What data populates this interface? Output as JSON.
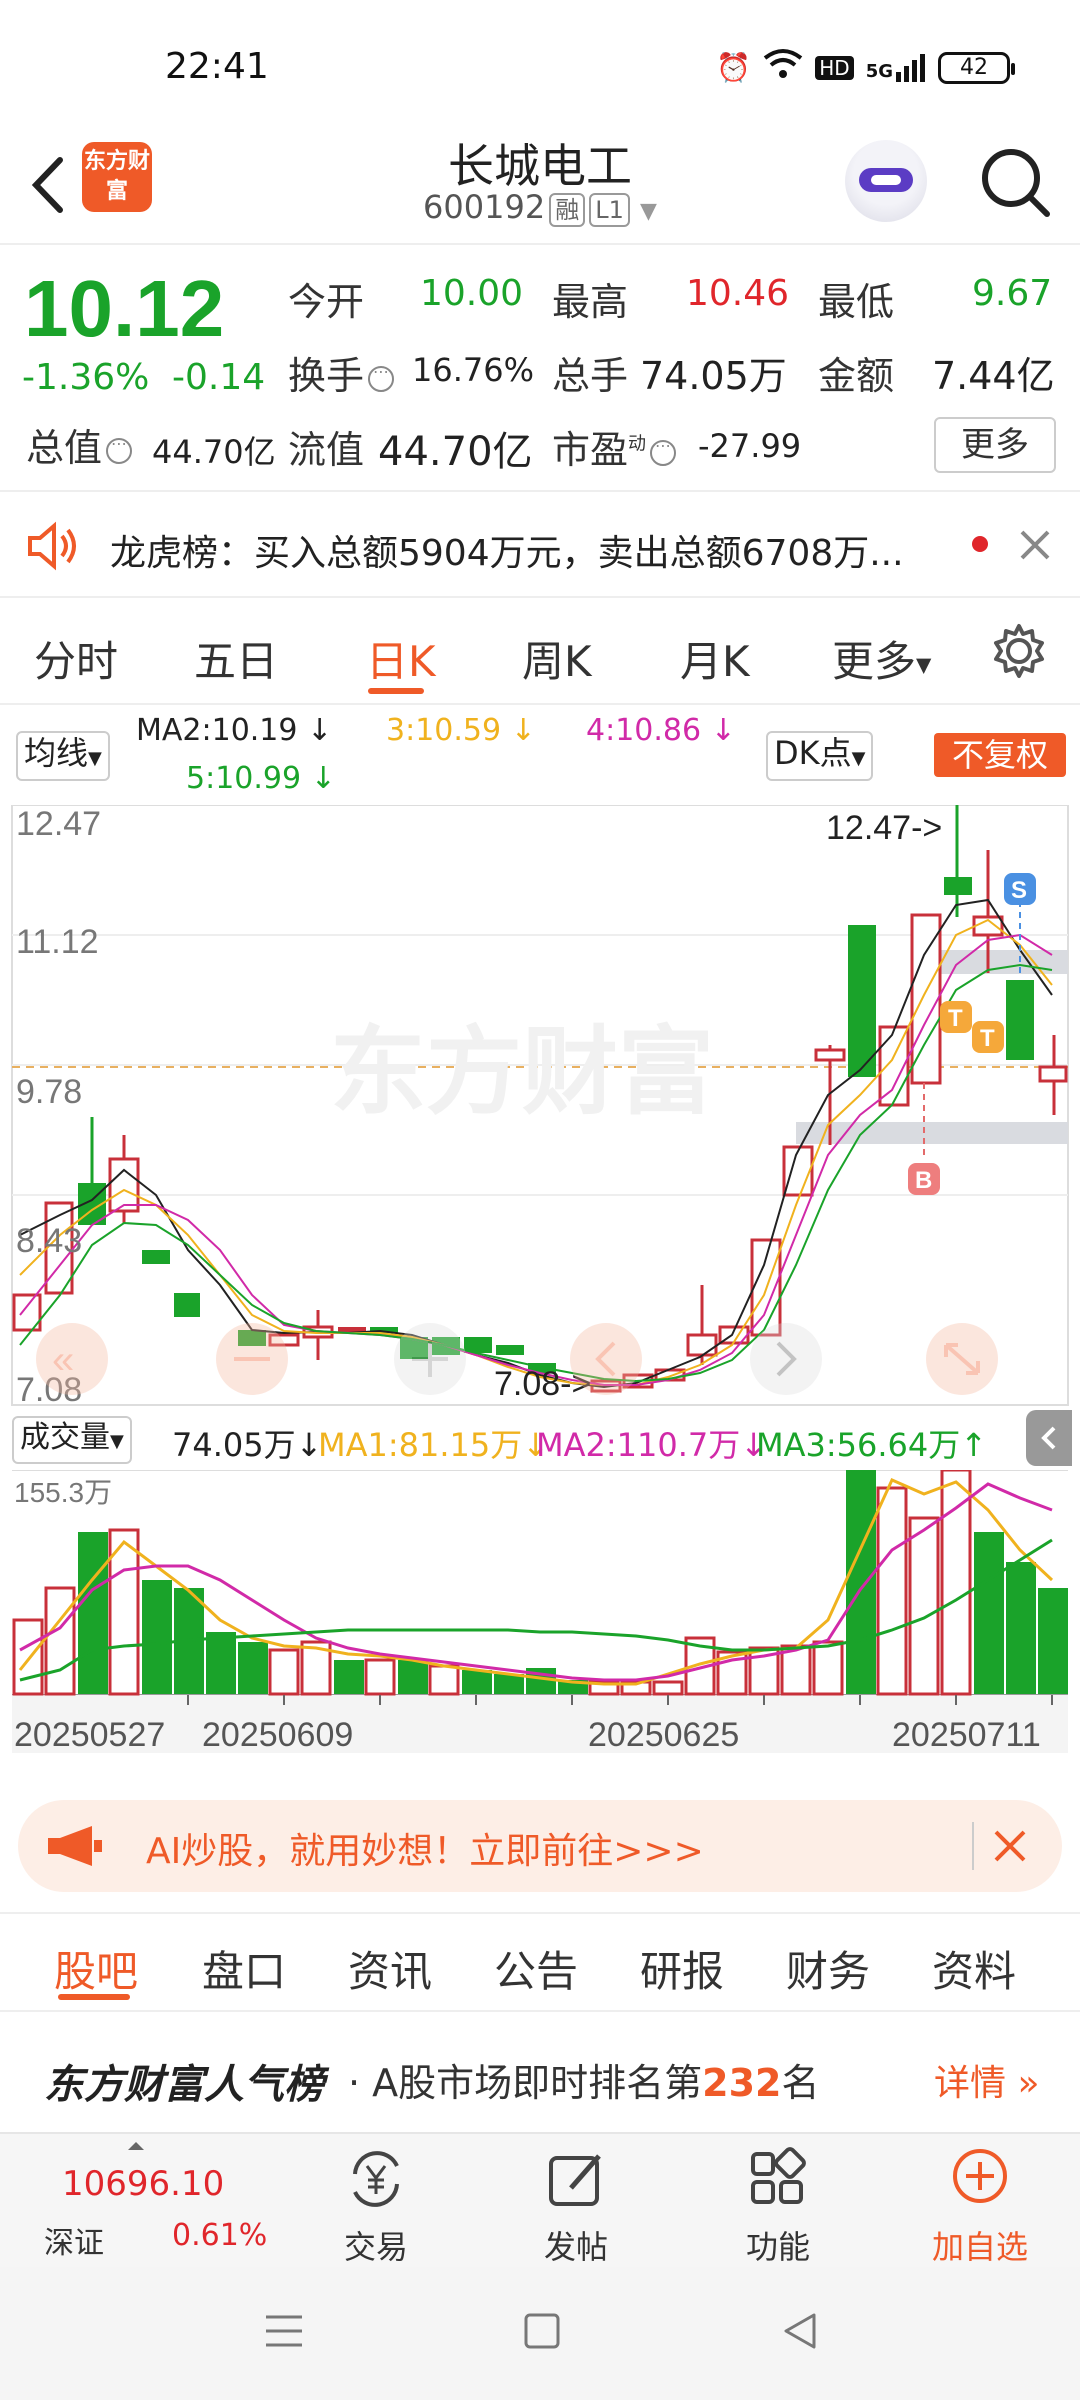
{
  "status_bar": {
    "time": "22:41",
    "hd": "HD",
    "net": "5G",
    "battery": "42"
  },
  "header": {
    "logo_text": "东方财富",
    "stock_name": "长城电工",
    "stock_code": "600192",
    "tag_rong": "融",
    "tag_level": "L1"
  },
  "quote": {
    "price": "10.12",
    "change_pct": "-1.36%",
    "change_amt": "-0.14",
    "open_label": "今开",
    "open": "10.00",
    "high_label": "最高",
    "high": "10.46",
    "low_label": "最低",
    "low": "9.67",
    "turnover_label": "换手",
    "turnover": "16.76%",
    "volume_label": "总手",
    "volume": "74.05万",
    "amount_label": "金额",
    "amount": "7.44亿",
    "mktcap_label": "总值",
    "mktcap": "44.70亿",
    "float_label": "流值",
    "float_cap": "44.70亿",
    "pe_label": "市盈",
    "pe_sup": "动",
    "pe": "-27.99",
    "more_label": "更多"
  },
  "notice": {
    "text": "龙虎榜：买入总额5904万元，卖出总额6708万..."
  },
  "tabs": [
    "分时",
    "五日",
    "日K",
    "周K",
    "月K",
    "更多"
  ],
  "ma_bar": {
    "selector": "均线",
    "ma2": "MA2:10.19",
    "ma3": "3:10.59",
    "ma4": "4:10.86",
    "ma5": "5:10.99",
    "dk_label": "DK点",
    "fuquan_label": "不复权"
  },
  "kline": {
    "y_ticks": [
      "12.47",
      "11.12",
      "9.78",
      "8.43",
      "7.08"
    ],
    "high_marker": "12.47->",
    "low_marker": "7.08->",
    "watermark": "东方财富",
    "tags": {
      "s": "S",
      "b": "B",
      "t1": "T",
      "t2": "T"
    }
  },
  "volume": {
    "selector": "成交量",
    "vol": "74.05万",
    "ma1": "MA1:81.15万",
    "ma2": "MA2:110.7万",
    "ma3": "MA3:56.64万",
    "y_max": "155.3万"
  },
  "dates": [
    "20250527",
    "20250609",
    "20250625",
    "20250711"
  ],
  "ad": {
    "text": "AI炒股，就用妙想！立即前往>>>"
  },
  "bottom_tabs": [
    "股吧",
    "盘口",
    "资讯",
    "公告",
    "研报",
    "财务",
    "资料"
  ],
  "rank": {
    "brand": "东方财富人气榜",
    "prefix": "· A股市场即时排名第",
    "num": "232",
    "suffix": "名",
    "detail": "详情"
  },
  "toolbar": {
    "index_value": "10696.10",
    "index_name": "深证",
    "index_change": "0.61%",
    "trade": "交易",
    "post": "发帖",
    "func": "功能",
    "add": "加自选"
  },
  "colors": {
    "accent": "#ef5a28",
    "up": "#e0262b",
    "down": "#1aa32a",
    "ma1": "#f0b21e",
    "ma2": "#d12aa8",
    "ma3": "#1aa32a"
  }
}
